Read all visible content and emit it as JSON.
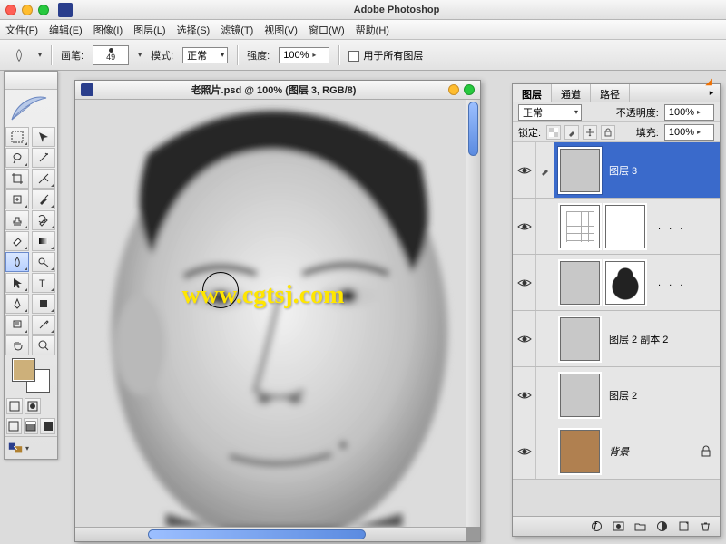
{
  "app": {
    "title": "Adobe Photoshop"
  },
  "menu": {
    "file": "文件(F)",
    "edit": "编辑(E)",
    "image": "图像(I)",
    "layer": "图层(L)",
    "select": "选择(S)",
    "filter": "滤镜(T)",
    "view": "视图(V)",
    "window": "窗口(W)",
    "help": "帮助(H)"
  },
  "options": {
    "brush_label": "画笔:",
    "brush_size": "49",
    "mode_label": "模式:",
    "mode_value": "正常",
    "strength_label": "强度:",
    "strength_value": "100%",
    "all_layers_label": "用于所有图层",
    "all_layers_checked": false
  },
  "document": {
    "title": "老照片.psd @ 100% (图层 3, RGB/8)"
  },
  "watermark": "www.cgtsj.com",
  "panel": {
    "tabs": {
      "layers": "图层",
      "channels": "通道",
      "paths": "路径"
    },
    "blend_value": "正常",
    "opacity_label": "不透明度:",
    "opacity_value": "100%",
    "lock_label": "锁定:",
    "fill_label": "填充:",
    "fill_value": "100%",
    "layers": [
      {
        "name": "图层 3",
        "selected": true,
        "thumbs": [
          "portrait"
        ]
      },
      {
        "name": "...",
        "selected": false,
        "thumbs": [
          "curves",
          "mask-white"
        ],
        "dots": true
      },
      {
        "name": "...",
        "selected": false,
        "thumbs": [
          "portrait",
          "bw"
        ],
        "dots": true
      },
      {
        "name": "图层 2 副本 2",
        "selected": false,
        "thumbs": [
          "portrait"
        ]
      },
      {
        "name": "图层 2",
        "selected": false,
        "thumbs": [
          "portrait"
        ]
      },
      {
        "name": "背景",
        "selected": false,
        "thumbs": [
          "color"
        ],
        "locked": true,
        "italic": true
      }
    ]
  },
  "colors": {
    "foreground": "#cdb07a",
    "background": "#ffffff",
    "accent": "#3a6acb"
  }
}
